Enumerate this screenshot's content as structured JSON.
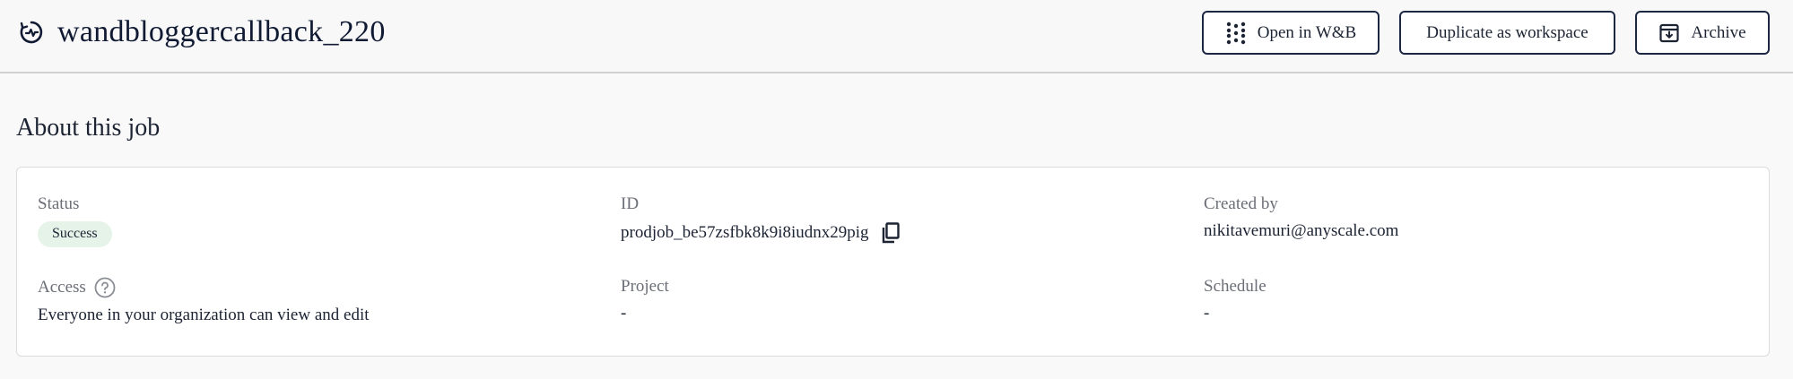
{
  "header": {
    "title": "wandbloggercallback_220",
    "title_icon": "job-activity-icon",
    "buttons": {
      "open_wandb": "Open in W&B",
      "duplicate": "Duplicate as workspace",
      "archive": "Archive"
    }
  },
  "about": {
    "section_title": "About this job",
    "status": {
      "label": "Status",
      "value": "Success"
    },
    "id": {
      "label": "ID",
      "value": "prodjob_be57zsfbk8k9i8iudnx29pig"
    },
    "created_by": {
      "label": "Created by",
      "value": "nikitavemuri@anyscale.com"
    },
    "access": {
      "label": "Access",
      "value": "Everyone in your organization can view and edit"
    },
    "project": {
      "label": "Project",
      "value": "-"
    },
    "schedule": {
      "label": "Schedule",
      "value": "-"
    }
  },
  "colors": {
    "success_badge_bg": "#e6f3e9",
    "button_border": "#1c2744",
    "text_primary": "#1c2333",
    "text_muted": "#6b6e76"
  }
}
